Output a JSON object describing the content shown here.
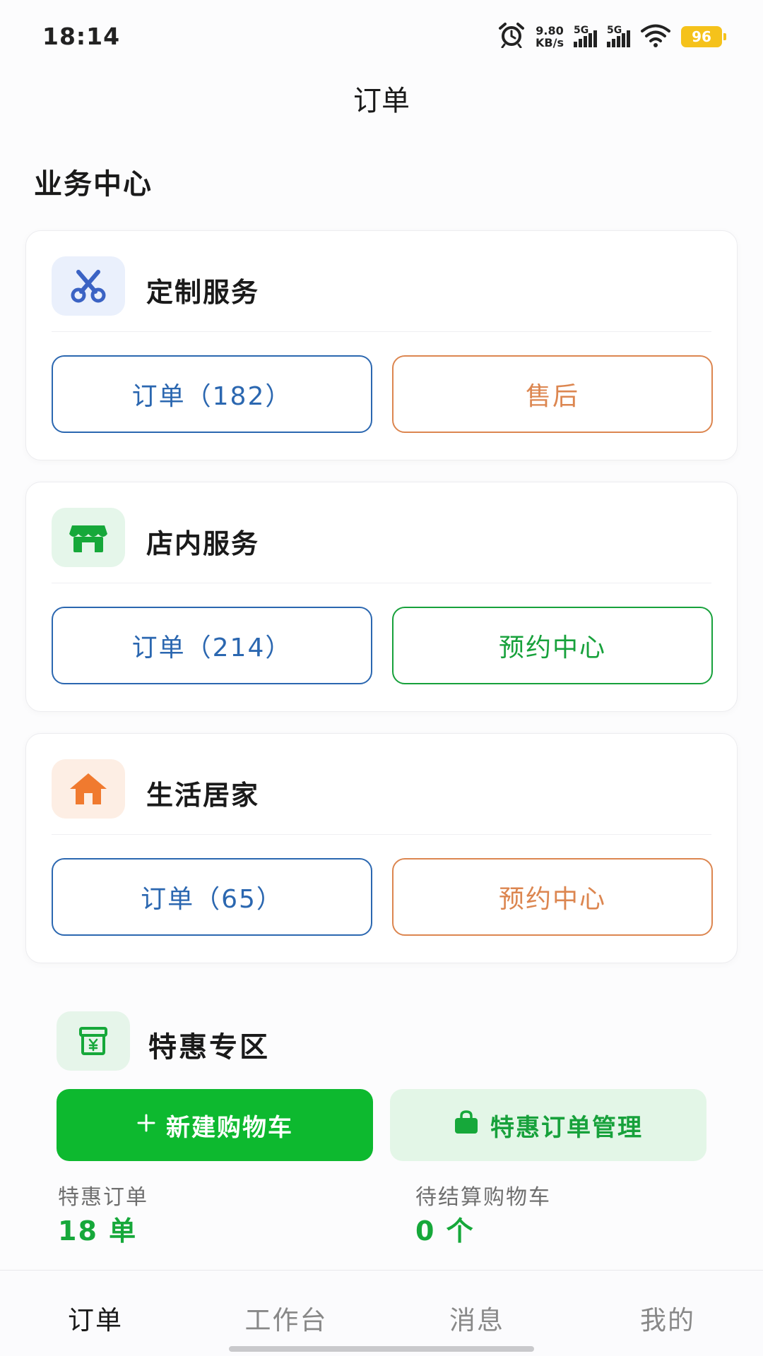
{
  "status_bar": {
    "time": "18:14",
    "net_speed_value": "9.80",
    "net_speed_unit": "KB/s",
    "signal_1_label": "5G",
    "signal_2_label": "5G",
    "battery": "96"
  },
  "nav": {
    "title": "订单"
  },
  "business_center": {
    "title": "业务中心"
  },
  "cards": [
    {
      "title": "定制服务",
      "icon": "scissors-icon",
      "left_button": "订单（182）",
      "right_button": "售后",
      "accent": "#dc8650"
    },
    {
      "title": "店内服务",
      "icon": "storefront-icon",
      "left_button": "订单（214）",
      "right_button": "预约中心",
      "accent": "#17a13b"
    },
    {
      "title": "生活居家",
      "icon": "house-icon",
      "left_button": "订单（65）",
      "right_button": "预约中心",
      "accent": "#dc8650"
    }
  ],
  "promo": {
    "title": "特惠专区",
    "icon": "yuan-box-icon",
    "primary_button": "新建购物车",
    "secondary_button": "特惠订单管理",
    "stats": [
      {
        "label": "特惠订单",
        "value": "18 单"
      },
      {
        "label": "待结算购物车",
        "value": "0 个"
      }
    ]
  },
  "tab_bar": {
    "tabs": [
      {
        "label": "订单",
        "active": true
      },
      {
        "label": "工作台",
        "active": false
      },
      {
        "label": "消息",
        "active": false
      },
      {
        "label": "我的",
        "active": false
      }
    ]
  },
  "colors": {
    "blue": "#2b67b0",
    "orange": "#dc8650",
    "green": "#17a13b",
    "primary_green": "#0db92f",
    "battery": "#f5c21b"
  }
}
